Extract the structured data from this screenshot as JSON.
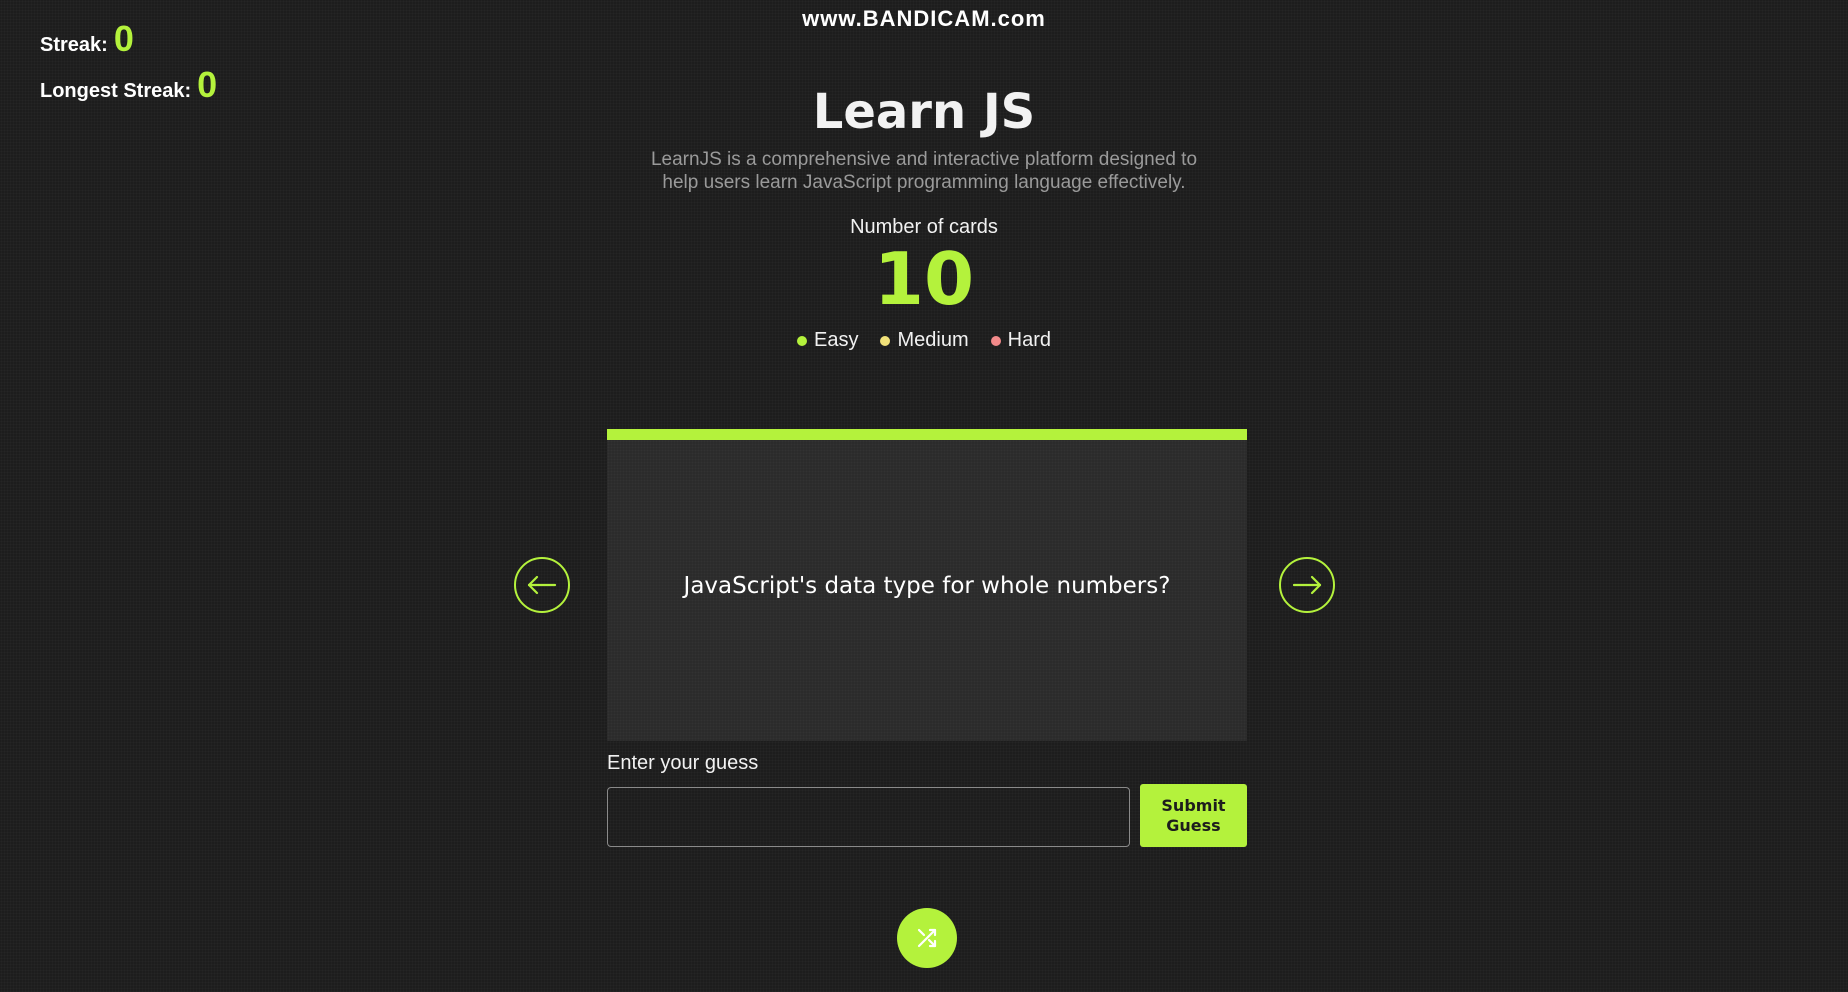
{
  "watermark": "www.BANDICAM.com",
  "streak": {
    "label": "Streak:",
    "value": "0"
  },
  "longest_streak": {
    "label": "Longest Streak:",
    "value": "0"
  },
  "header": {
    "title": "Learn JS",
    "description": "LearnJS is a comprehensive and interactive platform designed to help users learn JavaScript programming language effectively."
  },
  "cards": {
    "count_label": "Number of cards",
    "count": "10"
  },
  "legend": [
    {
      "label": "Easy",
      "color": "#b4f23c"
    },
    {
      "label": "Medium",
      "color": "#f2e27a"
    },
    {
      "label": "Hard",
      "color": "#f28a8a"
    }
  ],
  "card": {
    "question": "JavaScript's data type for whole numbers?",
    "accent_color": "#b4f23c"
  },
  "navigation": {
    "prev_icon": "arrow-left-icon",
    "next_icon": "arrow-right-icon"
  },
  "guess": {
    "label": "Enter your guess",
    "value": "",
    "placeholder": "",
    "submit_label": "Submit Guess"
  },
  "shuffle": {
    "icon": "shuffle-icon"
  },
  "colors": {
    "accent": "#b4f23c",
    "background": "#1d1d1d",
    "card_background": "#2b2b2b"
  }
}
